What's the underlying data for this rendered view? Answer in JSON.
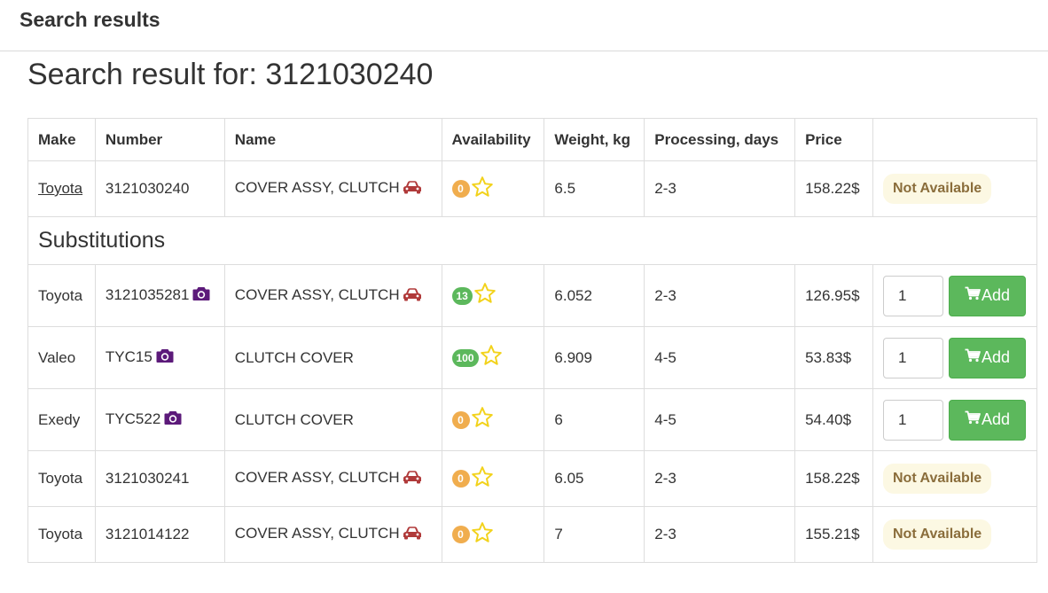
{
  "panel": {
    "title": "Search results"
  },
  "search": {
    "title_prefix": "Search result for: ",
    "query": "3121030240",
    "title": "Search result for: 3121030240"
  },
  "table": {
    "headers": [
      "Make",
      "Number",
      "Name",
      "Availability",
      "Weight, kg",
      "Processing, days",
      "Price",
      ""
    ],
    "substitutions_label": "Substitutions",
    "not_available_label": "Not Available",
    "add_label": "Add",
    "main_row": {
      "make": "Toyota",
      "number": "3121030240",
      "name": "COVER ASSY, CLUTCH",
      "availability": "0",
      "weight": "6.5",
      "processing": "2-3",
      "price": "158.22$"
    },
    "rows": [
      {
        "make": "Toyota",
        "number": "3121035281",
        "name": "COVER ASSY, CLUTCH",
        "availability": "13",
        "weight": "6.052",
        "processing": "2-3",
        "price": "126.95$",
        "qty": "1"
      },
      {
        "make": "Valeo",
        "number": "TYC15",
        "name": "CLUTCH COVER",
        "availability": "100",
        "weight": "6.909",
        "processing": "4-5",
        "price": "53.83$",
        "qty": "1"
      },
      {
        "make": "Exedy",
        "number": "TYC522",
        "name": "CLUTCH COVER",
        "availability": "0",
        "weight": "6",
        "processing": "4-5",
        "price": "54.40$",
        "qty": "1"
      },
      {
        "make": "Toyota",
        "number": "3121030241",
        "name": "COVER ASSY, CLUTCH",
        "availability": "0",
        "weight": "6.05",
        "processing": "2-3",
        "price": "158.22$"
      },
      {
        "make": "Toyota",
        "number": "3121014122",
        "name": "COVER ASSY, CLUTCH",
        "availability": "0",
        "weight": "7",
        "processing": "2-3",
        "price": "155.21$"
      }
    ]
  },
  "icons": {
    "car": "car-icon",
    "camera": "camera-icon",
    "star": "star-outline-icon",
    "cart": "shopping-cart-icon"
  },
  "colors": {
    "badge_zero": "#f0ad4e",
    "badge_stock": "#5cb85c",
    "star": "#f2d21b",
    "car": "#b03a3a",
    "camera": "#5c1a7a",
    "add_button": "#5cb85c",
    "not_available_bg": "#fcf8e3",
    "not_available_text": "#8a6d3b"
  }
}
